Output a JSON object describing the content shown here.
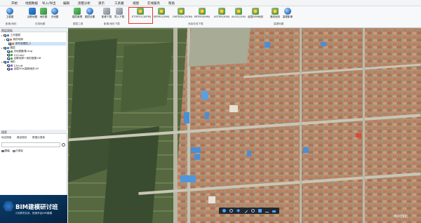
{
  "menu": [
    "开始",
    "地图数据",
    "导入/导出",
    "编辑",
    "测量分析",
    "演示",
    "工具箱",
    "视图",
    "在线服务",
    "帮助"
  ],
  "ribbon": {
    "groups": [
      {
        "label": "影像/地形"
      },
      {
        "label": "在线地图"
      },
      {
        "label": "图层工具"
      },
      {
        "label": "影像/地形下载"
      },
      {
        "label": "添加在线下载"
      },
      {
        "label": "高德地图"
      }
    ],
    "buttons": [
      {
        "label": "卫星图",
        "icon": "satellite-icon"
      },
      {
        "label": "谷歌地图",
        "icon": "google-map-icon"
      },
      {
        "label": "地形图",
        "icon": "terrain-icon"
      },
      {
        "label": "天地图",
        "icon": "tianditu-icon"
      },
      {
        "label": "图层管理",
        "icon": "layers-icon"
      },
      {
        "label": "图层设置",
        "icon": "layer-settings-icon"
      },
      {
        "label": "影像下载",
        "icon": "image-download-icon"
      },
      {
        "label": "导入下载",
        "icon": "import-download-icon"
      },
      {
        "label": "ETOPO1(1KFM)",
        "icon": "etopo-icon"
      },
      {
        "label": "SRTM1(30M)",
        "icon": "srtm1-icon"
      },
      {
        "label": "GMTED2(250M)",
        "icon": "gmted-icon"
      },
      {
        "label": "SRTM3(90M)",
        "icon": "srtm3-icon"
      },
      {
        "label": "ASTER(30M)",
        "icon": "aster-icon"
      },
      {
        "label": "ALOS(12M)",
        "icon": "alos-icon"
      },
      {
        "label": "全国DEM地形",
        "icon": "dem-icon"
      },
      {
        "label": "离线地形",
        "icon": "offline-terrain-icon"
      },
      {
        "label": "高德影像",
        "icon": "amap-icon"
      }
    ]
  },
  "layers_panel": {
    "title": "图层面板",
    "items": [
      {
        "label": "工作图层",
        "level": 0
      },
      {
        "label": "我的地标",
        "level": 1
      },
      {
        "label": "未命名图层_1",
        "level": 2
      },
      {
        "label": "图层",
        "level": 0
      },
      {
        "label": "天地图影像.img",
        "level": 1
      },
      {
        "label": "123.kml",
        "level": 1
      },
      {
        "label": "谷歌地球+地形数据.tiff",
        "level": 1
      },
      {
        "label": "地形",
        "level": 0
      },
      {
        "label": "12m.dt",
        "level": 1
      },
      {
        "label": "全国30m高程地形.tif",
        "level": 1
      }
    ]
  },
  "search_panel": {
    "title": "搜索",
    "tabs": [
      "地名搜索",
      "路径规划",
      "数据点搜索"
    ],
    "options": [
      "图幅",
      "行政区"
    ]
  },
  "ad": {
    "title": "BIM建模研讨班",
    "subtitle": "2天精学实训，快速学会BIM建模"
  },
  "watermark": "BIM知识"
}
